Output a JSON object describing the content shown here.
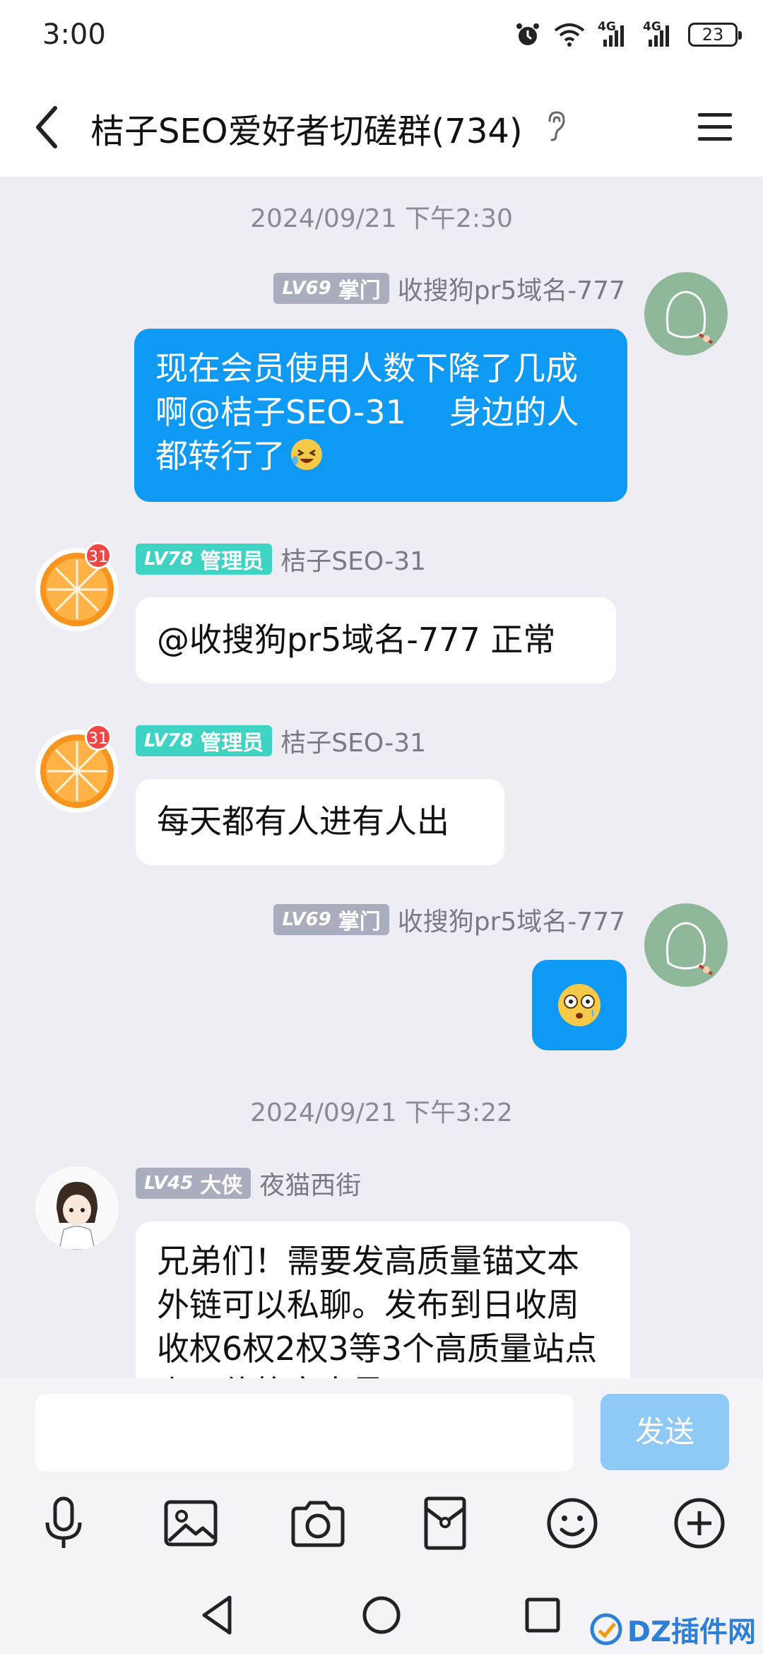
{
  "status_bar": {
    "time": "3:00",
    "battery": "23",
    "network_labels": [
      "4G",
      "4G"
    ]
  },
  "header": {
    "back_icon": "chevron-left-icon",
    "title": "桔子SEO爱好者切磋群(734)",
    "ear_icon": "ear-icon",
    "menu_icon": "menu-icon"
  },
  "messages": {
    "timestamp1": "2024/09/21 下午2:30",
    "m1": {
      "level": "LV69",
      "role": "掌门",
      "sender": "收搜狗pr5域名-777",
      "text": "现在会员使用人数下降了几成啊@桔子SEO-31　 身边的人都转行了",
      "emoji": "laughing-tears-emoji"
    },
    "m2": {
      "level": "LV78",
      "role": "管理员",
      "sender": "桔子SEO-31",
      "unread": "31",
      "text": "@收搜狗pr5域名-777 正常"
    },
    "m3": {
      "level": "LV78",
      "role": "管理员",
      "sender": "桔子SEO-31",
      "unread": "31",
      "text": "每天都有人进有人出"
    },
    "m4": {
      "level": "LV69",
      "role": "掌门",
      "sender": "收搜狗pr5域名-777",
      "emoji": "shocked-face-emoji"
    },
    "timestamp2": "2024/09/21 下午3:22",
    "m5": {
      "level": "LV45",
      "role": "大侠",
      "sender": "夜猫西街",
      "text": "兄弟们！需要发高质量锚文本外链可以私聊。发布到日收周收权6权2权3等3个高质量站点上，价格实惠量"
    }
  },
  "input": {
    "value": "",
    "send_label": "发送"
  },
  "toolbar": {
    "icons": [
      "microphone-icon",
      "image-icon",
      "camera-icon",
      "red-packet-icon",
      "emoji-icon",
      "plus-icon"
    ]
  },
  "navbar": {
    "icons": [
      "back-triangle-icon",
      "home-circle-icon",
      "recents-square-icon"
    ]
  },
  "watermark": {
    "text": "DZ插件网"
  },
  "colors": {
    "outgoing_bubble": "#0e99f5",
    "admin_badge": "#3fd3c4",
    "member_badge": "#a9adbd",
    "send_button": "#8fcaf7",
    "chat_bg": "#ededf3"
  }
}
